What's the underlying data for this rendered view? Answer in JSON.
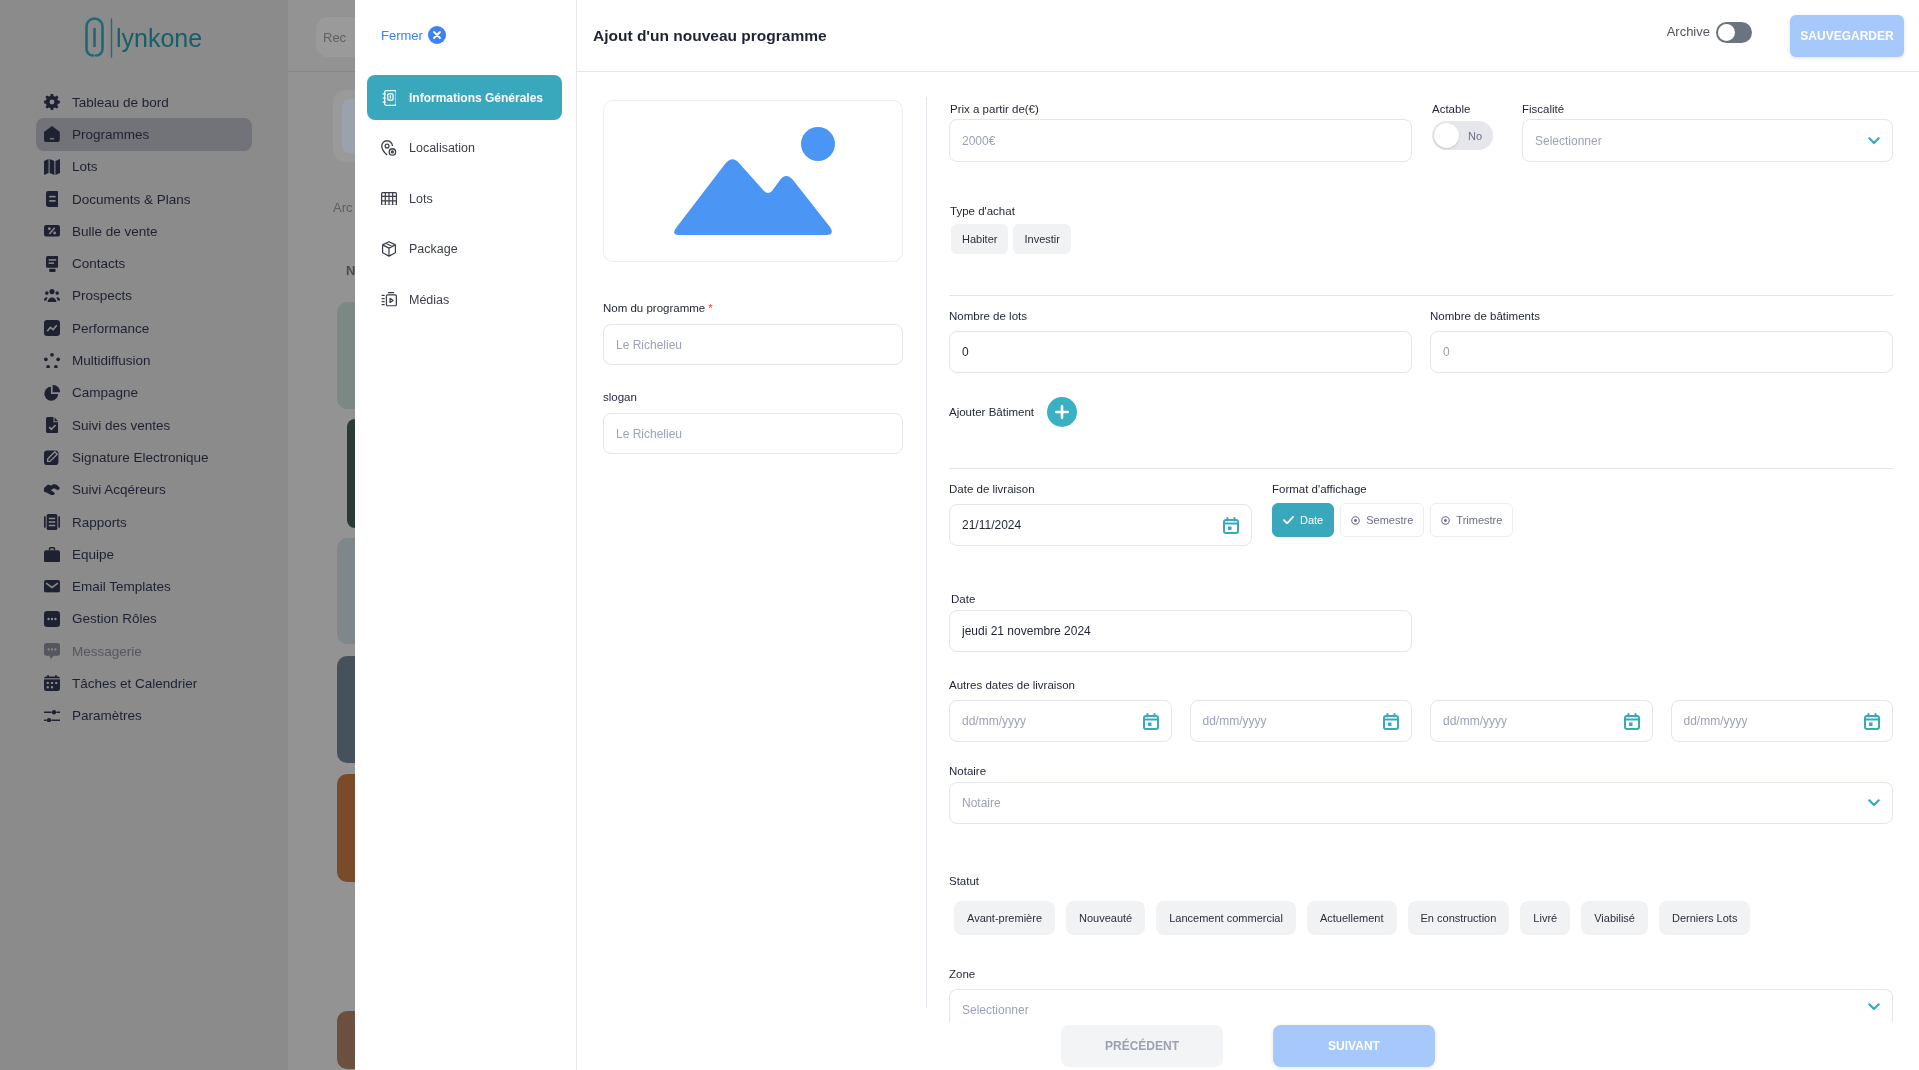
{
  "sidebar": {
    "logo": "lynkone",
    "items": [
      {
        "label": "Tableau de bord",
        "selected": false,
        "disabled": false
      },
      {
        "label": "Programmes",
        "selected": true,
        "disabled": false
      },
      {
        "label": "Lots",
        "selected": false,
        "disabled": false
      },
      {
        "label": "Documents & Plans",
        "selected": false,
        "disabled": false
      },
      {
        "label": "Bulle de vente",
        "selected": false,
        "disabled": false
      },
      {
        "label": "Contacts",
        "selected": false,
        "disabled": false
      },
      {
        "label": "Prospects",
        "selected": false,
        "disabled": false
      },
      {
        "label": "Performance",
        "selected": false,
        "disabled": false
      },
      {
        "label": "Multidiffusion",
        "selected": false,
        "disabled": false
      },
      {
        "label": "Campagne",
        "selected": false,
        "disabled": false
      },
      {
        "label": "Suivi des ventes",
        "selected": false,
        "disabled": false
      },
      {
        "label": "Signature Electronique",
        "selected": false,
        "disabled": false
      },
      {
        "label": "Suivi Acqéreurs",
        "selected": false,
        "disabled": false
      },
      {
        "label": "Rapports",
        "selected": false,
        "disabled": false
      },
      {
        "label": "Equipe",
        "selected": false,
        "disabled": false
      },
      {
        "label": "Email Templates",
        "selected": false,
        "disabled": false
      },
      {
        "label": "Gestion Rôles",
        "selected": false,
        "disabled": false
      },
      {
        "label": "Messagerie",
        "selected": false,
        "disabled": true
      },
      {
        "label": "Tâches et Calendrier",
        "selected": false,
        "disabled": false
      },
      {
        "label": "Paramètres",
        "selected": false,
        "disabled": false
      }
    ]
  },
  "background_page": {
    "search": {
      "placeholder": "Rec"
    },
    "fragments": [
      {
        "text": "Arc",
        "kind": "label"
      },
      {
        "text": "N",
        "kind": "heading"
      }
    ]
  },
  "drawer": {
    "close": "Fermer",
    "nav": [
      {
        "label": "Informations Générales",
        "selected": true
      },
      {
        "label": "Localisation",
        "selected": false
      },
      {
        "label": "Lots",
        "selected": false
      },
      {
        "label": "Package",
        "selected": false
      },
      {
        "label": "Médias",
        "selected": false
      }
    ]
  },
  "header": {
    "title": "Ajout d'un nouveau programme",
    "archive": {
      "label": "Archive",
      "on": false
    },
    "save": {
      "label": "SAUVEGARDER",
      "disabled": true
    }
  },
  "form": {
    "name": {
      "label": "Nom du programme",
      "required_mark": "*",
      "placeholder": "Le Richelieu"
    },
    "slogan": {
      "label": "slogan",
      "placeholder": "Le Richelieu"
    },
    "price": {
      "label": "Prix a partir de(€)",
      "placeholder": "2000€"
    },
    "actable": {
      "label": "Actable",
      "on": false,
      "state_text": "No"
    },
    "fiscalite": {
      "label": "Fiscalité",
      "placeholder": "Selectionner"
    },
    "type_achat": {
      "label": "Type d'achat",
      "options": [
        {
          "label": "Habiter",
          "selected": false
        },
        {
          "label": "Investir",
          "selected": false
        }
      ]
    },
    "nombre_lots": {
      "label": "Nombre de lots",
      "value": "0"
    },
    "nombre_batiments": {
      "label": "Nombre de bâtiments",
      "placeholder": "0"
    },
    "add_building": {
      "label": "Ajouter Bâtiment"
    },
    "date_livraison": {
      "label": "Date de livraison",
      "value": "21/11/2024"
    },
    "format_affichage": {
      "label": "Format d'affichage",
      "options": [
        {
          "label": "Date",
          "selected": true
        },
        {
          "label": "Semestre",
          "selected": false
        },
        {
          "label": "Trimestre",
          "selected": false
        }
      ]
    },
    "date": {
      "label": "Date",
      "value": "jeudi 21 novembre 2024"
    },
    "autres_dates": {
      "label": "Autres dates de livraison",
      "fields": [
        {
          "placeholder": "dd/mm/yyyy"
        },
        {
          "placeholder": "dd/mm/yyyy"
        },
        {
          "placeholder": "dd/mm/yyyy"
        },
        {
          "placeholder": "dd/mm/yyyy"
        }
      ]
    },
    "notaire": {
      "label": "Notaire",
      "placeholder": "Notaire"
    },
    "statut": {
      "label": "Statut",
      "options": [
        {
          "label": "Avant-première",
          "selected": false
        },
        {
          "label": "Nouveauté",
          "selected": false
        },
        {
          "label": "Lancement commercial",
          "selected": false
        },
        {
          "label": "Actuellement",
          "selected": false
        },
        {
          "label": "En construction",
          "selected": false
        },
        {
          "label": "Livré",
          "selected": false
        },
        {
          "label": "Viabilisé",
          "selected": false
        },
        {
          "label": "Derniers Lots",
          "selected": false
        }
      ]
    },
    "zone": {
      "label": "Zone",
      "placeholder": "Selectionner"
    }
  },
  "footer": {
    "previous": {
      "label": "PRÉCÉDENT",
      "disabled": true
    },
    "next": {
      "label": "SUIVANT",
      "disabled": true
    }
  }
}
